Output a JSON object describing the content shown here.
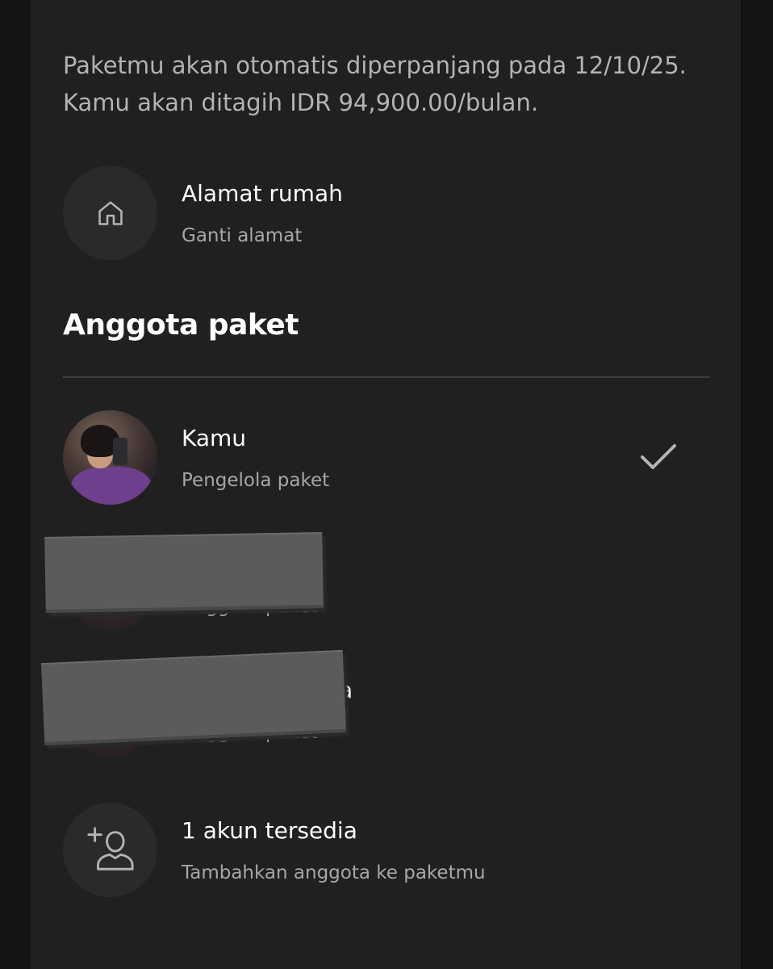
{
  "renewal": {
    "line1": "Paketmu akan otomatis diperpanjang pada 12/10/25.",
    "line2": "Kamu akan ditagih IDR 94,900.00/bulan."
  },
  "address": {
    "icon": "home-icon",
    "title": "Alamat rumah",
    "subtitle": "Ganti alamat"
  },
  "members_section": {
    "title": "Anggota paket",
    "members": [
      {
        "name": "Kamu",
        "role": "Pengelola paket",
        "selected": true
      },
      {
        "name": "",
        "role": "Anggota paket",
        "redacted": true
      },
      {
        "name": "a",
        "role": "Anggota paket",
        "redacted": true
      }
    ]
  },
  "add_member": {
    "icon": "add-person-icon",
    "title": "1 akun tersedia",
    "subtitle": "Tambahkan anggota ke paketmu"
  },
  "colors": {
    "background": "#202020",
    "text_primary": "#ffffff",
    "text_secondary": "#a7a7a7"
  }
}
